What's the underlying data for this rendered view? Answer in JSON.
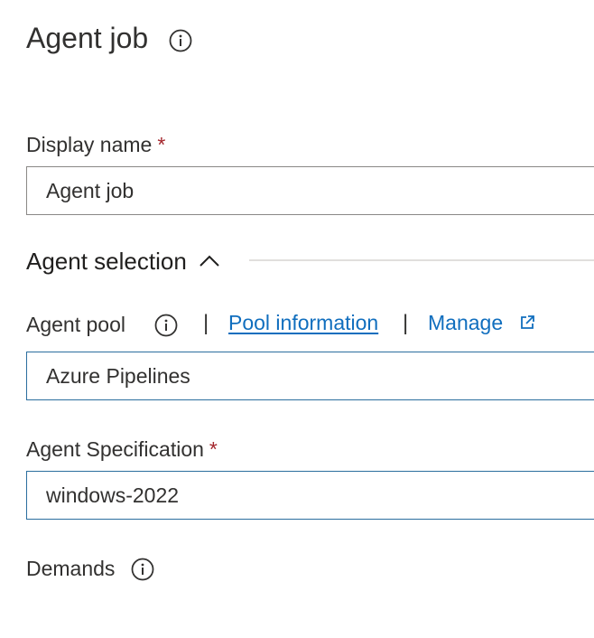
{
  "header": {
    "title": "Agent job",
    "info_icon": "info-icon"
  },
  "display_name": {
    "label": "Display name",
    "required_mark": "*",
    "value": "Agent job"
  },
  "agent_selection": {
    "title": "Agent selection",
    "toggle_icon": "chevron-up-icon",
    "agent_pool": {
      "label": "Agent pool",
      "info_icon": "info-icon",
      "separator": "|",
      "pool_info_link": "Pool information",
      "manage_link": "Manage",
      "manage_icon": "external-link-icon",
      "value": "Azure Pipelines"
    },
    "agent_specification": {
      "label": "Agent Specification",
      "required_mark": "*",
      "value": "windows-2022"
    }
  },
  "demands": {
    "label": "Demands",
    "info_icon": "info-icon"
  },
  "colors": {
    "text": "#323130",
    "required": "#a4262c",
    "link": "#106ebe",
    "focus_border": "#2b6e9e",
    "border": "#8a8886"
  }
}
